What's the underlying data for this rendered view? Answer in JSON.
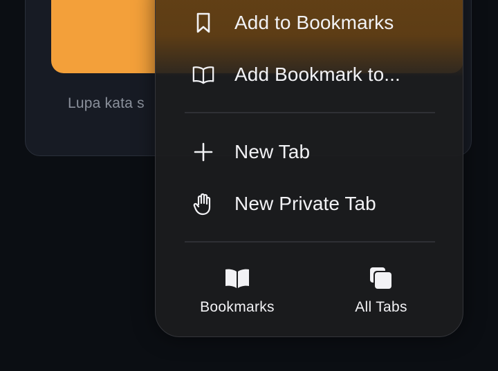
{
  "background_page": {
    "forgot_link_text": "Lupa kata s",
    "accent_color": "#f3a03a"
  },
  "menu": {
    "items": [
      {
        "label": "Add to Bookmarks",
        "icon": "bookmark-icon"
      },
      {
        "label": "Add Bookmark to...",
        "icon": "open-book-icon"
      },
      {
        "label": "New Tab",
        "icon": "plus-icon"
      },
      {
        "label": "New Private Tab",
        "icon": "hand-icon"
      }
    ],
    "bottom": [
      {
        "label": "Bookmarks",
        "icon": "book-filled-icon"
      },
      {
        "label": "All Tabs",
        "icon": "tabs-stack-icon"
      }
    ]
  }
}
